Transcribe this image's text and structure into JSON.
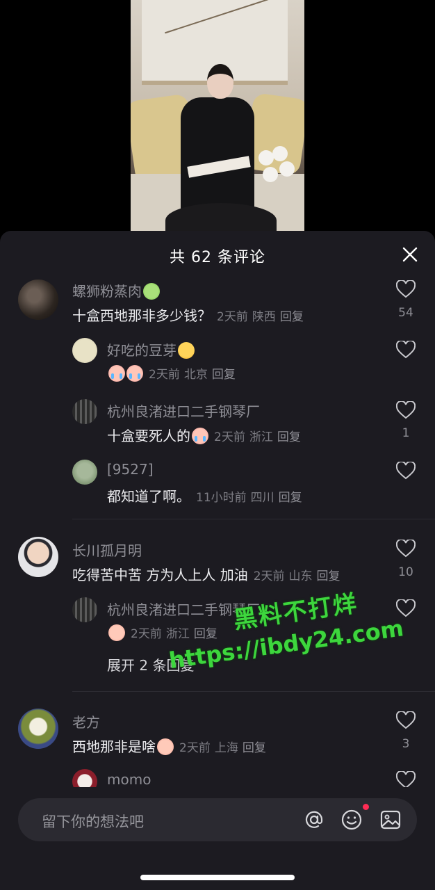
{
  "sheet": {
    "title": "共 62 条评论"
  },
  "comments": [
    {
      "name": "螺狮粉蒸肉",
      "name_emoji": "sick",
      "text": "十盒西地那非多少钱？",
      "time": "2天前",
      "location": "陕西",
      "reply": "回复",
      "likes": "54"
    },
    {
      "name": "好吃的豆芽",
      "name_emoji": "smile",
      "text": "",
      "time": "2天前",
      "location": "北京",
      "reply": "回复",
      "likes": ""
    },
    {
      "name": "杭州良渚进口二手钢琴厂",
      "text": "十盒要死人的",
      "time": "2天前",
      "location": "浙江",
      "reply": "回复",
      "likes": "1"
    },
    {
      "name": "[9527]",
      "text": "都知道了啊。",
      "time": "11小时前",
      "location": "四川",
      "reply": "回复",
      "likes": ""
    },
    {
      "name": "长川孤月明",
      "text": "吃得苦中苦 方为人上人 加油",
      "time": "2天前",
      "location": "山东",
      "reply": "回复",
      "likes": "10"
    },
    {
      "name": "杭州良渚进口二手钢琴厂",
      "text": "",
      "time": "2天前",
      "location": "浙江",
      "reply": "回复",
      "likes": ""
    },
    {
      "name": "老方",
      "text": "西地那非是啥",
      "time": "2天前",
      "location": "上海",
      "reply": "回复",
      "likes": "3"
    },
    {
      "name": "momo"
    }
  ],
  "expand_label": "展开 2 条回复",
  "watermark": {
    "line1": "黑料不打烊",
    "line2": "https://ibdy24.com"
  },
  "input": {
    "placeholder": "留下你的想法吧"
  },
  "icons": {
    "close": "close-icon",
    "like": "heart-outline-icon",
    "mention": "at-icon",
    "emoji": "smiley-icon",
    "image": "image-icon"
  },
  "colors": {
    "sheet_bg": "#1c1b21",
    "notification_dot": "#ff2c55",
    "watermark": "#3dd63d"
  }
}
